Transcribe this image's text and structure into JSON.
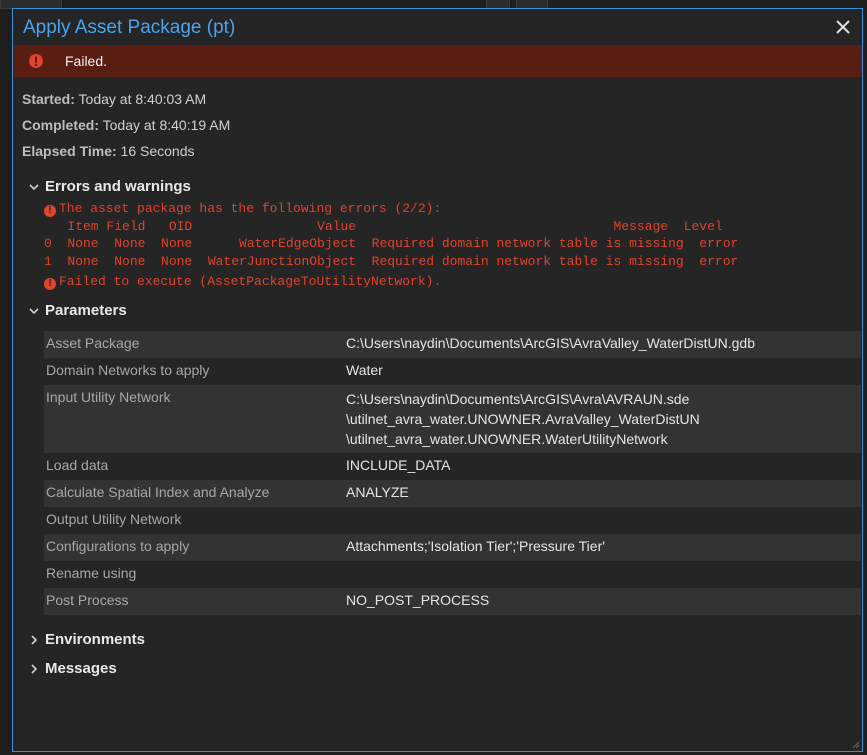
{
  "dialog": {
    "title": "Apply Asset Package (pt)"
  },
  "banner": {
    "status": "Failed.",
    "color": "#5a1d12"
  },
  "info": {
    "started_label": "Started:",
    "started_value": " Today at 8:40:03 AM",
    "completed_label": "Completed:",
    "completed_value": " Today at 8:40:19 AM",
    "elapsed_label": "Elapsed Time:",
    "elapsed_value": " 16 Seconds"
  },
  "errors": {
    "heading": "Errors and warnings",
    "line1": "The asset package has the following errors (2/2):",
    "header": "   Item Field   OID                Value                                 Message  Level",
    "row0": "0  None  None  None      WaterEdgeObject  Required domain network table is missing  error",
    "row1": "1  None  None  None  WaterJunctionObject  Required domain network table is missing  error",
    "line_fail": "Failed to execute (AssetPackageToUtilityNetwork)."
  },
  "parameters": {
    "heading": "Parameters",
    "rows": [
      {
        "label": "Asset Package",
        "value": "C:\\Users\\naydin\\Documents\\ArcGIS\\AvraValley_WaterDistUN.gdb"
      },
      {
        "label": "Domain Networks to apply",
        "value": "Water"
      },
      {
        "label": "Input Utility Network",
        "value1": "C:\\Users\\naydin\\Documents\\ArcGIS\\Avra\\AVRAUN.sde",
        "value2": "\\utilnet_avra_water.UNOWNER.AvraValley_WaterDistUN",
        "value3": "\\utilnet_avra_water.UNOWNER.WaterUtilityNetwork"
      },
      {
        "label": "Load data",
        "value": "INCLUDE_DATA"
      },
      {
        "label": "Calculate Spatial Index and Analyze",
        "value": "ANALYZE"
      },
      {
        "label": "Output Utility Network",
        "value": ""
      },
      {
        "label": "Configurations to apply",
        "value": "Attachments;'Isolation Tier';'Pressure Tier'"
      },
      {
        "label": "Rename using",
        "value": ""
      },
      {
        "label": "Post Process",
        "value": "NO_POST_PROCESS"
      }
    ]
  },
  "environments": {
    "heading": "Environments"
  },
  "messages": {
    "heading": "Messages"
  }
}
